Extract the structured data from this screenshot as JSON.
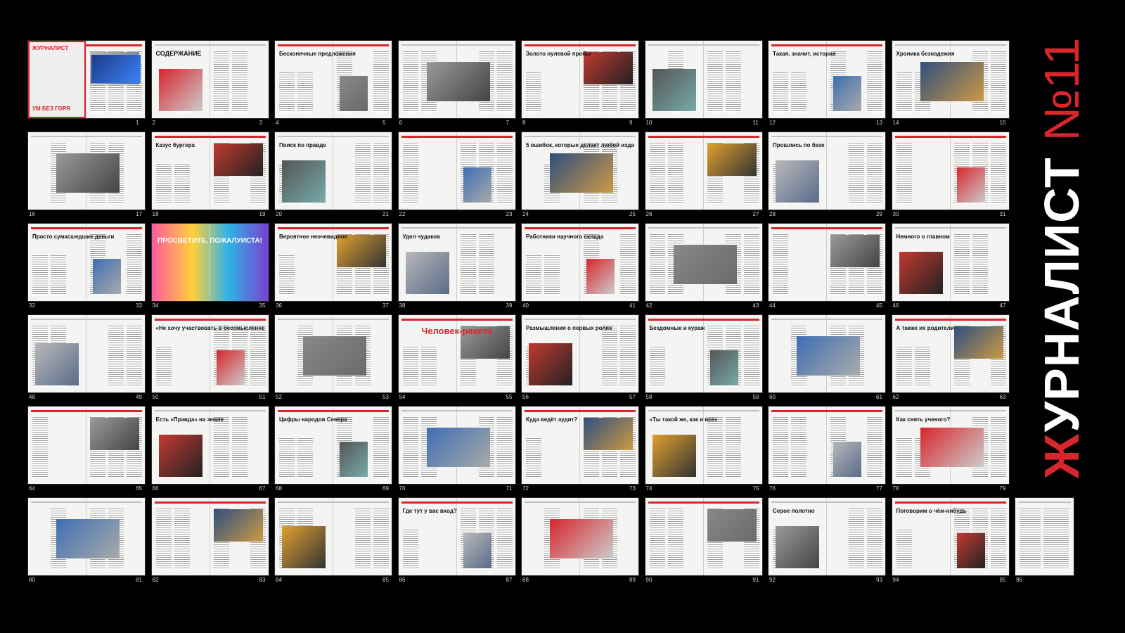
{
  "masthead": {
    "title": "ЖУРНАЛИСТ",
    "first_letter": "Ж",
    "rest": "УРНАЛИСТ",
    "issue": "№11"
  },
  "colors": {
    "background": "#000000",
    "accent": "#d8262c",
    "page": "#f4f4f2"
  },
  "rows": [
    {
      "spreads": [
        {
          "left": "",
          "right": "1",
          "headline": "ЖУРНАЛИСТ",
          "sub": "УМ БЕЗ ГОРЯ"
        },
        {
          "left": "2",
          "right": "3",
          "headline": "СОДЕРЖАНИЕ"
        },
        {
          "left": "4",
          "right": "5",
          "headline": "Бесконечные предложения"
        },
        {
          "left": "6",
          "right": "7",
          "headline": ""
        },
        {
          "left": "8",
          "right": "9",
          "headline": "Золото нулевой пробы"
        },
        {
          "left": "10",
          "right": "11",
          "headline": ""
        },
        {
          "left": "12",
          "right": "13",
          "headline": "Такая, значит, история"
        },
        {
          "left": "14",
          "right": "15",
          "headline": "Хроника безнадежия"
        }
      ]
    },
    {
      "spreads": [
        {
          "left": "16",
          "right": "17",
          "headline": ""
        },
        {
          "left": "18",
          "right": "19",
          "headline": "Казус бургера"
        },
        {
          "left": "20",
          "right": "21",
          "headline": "Поиск по правде"
        },
        {
          "left": "22",
          "right": "23",
          "headline": ""
        },
        {
          "left": "24",
          "right": "25",
          "headline": "5 ошибок, которые делает любой издатель"
        },
        {
          "left": "26",
          "right": "27",
          "headline": ""
        },
        {
          "left": "28",
          "right": "29",
          "headline": "Прошлись по базе"
        },
        {
          "left": "30",
          "right": "31",
          "headline": ""
        }
      ]
    },
    {
      "spreads": [
        {
          "left": "32",
          "right": "33",
          "headline": "Просто сумасшедшие деньги"
        },
        {
          "left": "34",
          "right": "35",
          "headline": "ПРОСВЕТИТЕ, ПОЖАЛУЙСТА!"
        },
        {
          "left": "36",
          "right": "37",
          "headline": "Вероятное неочевидное"
        },
        {
          "left": "38",
          "right": "39",
          "headline": "Удел чудаков"
        },
        {
          "left": "40",
          "right": "41",
          "headline": "Работники научного склада"
        },
        {
          "left": "42",
          "right": "43",
          "headline": ""
        },
        {
          "left": "44",
          "right": "45",
          "headline": ""
        },
        {
          "left": "46",
          "right": "47",
          "headline": "Немного о главном"
        }
      ]
    },
    {
      "spreads": [
        {
          "left": "48",
          "right": "49",
          "headline": ""
        },
        {
          "left": "50",
          "right": "51",
          "headline": "«Не хочу участвовать в бессмысленном накоплении знаний»"
        },
        {
          "left": "52",
          "right": "53",
          "headline": ""
        },
        {
          "left": "54",
          "right": "55",
          "headline": "Человек-ракета"
        },
        {
          "left": "56",
          "right": "57",
          "headline": "Размышления о первых ролях"
        },
        {
          "left": "58",
          "right": "59",
          "headline": "Бездомные и кураж"
        },
        {
          "left": "60",
          "right": "61",
          "headline": ""
        },
        {
          "left": "62",
          "right": "63",
          "headline": "А также их родители"
        }
      ]
    },
    {
      "spreads": [
        {
          "left": "64",
          "right": "65",
          "headline": ""
        },
        {
          "left": "66",
          "right": "67",
          "headline": "Есть «Правда» на земле"
        },
        {
          "left": "68",
          "right": "69",
          "headline": "Цифры народов Севера"
        },
        {
          "left": "70",
          "right": "71",
          "headline": ""
        },
        {
          "left": "72",
          "right": "73",
          "headline": "Куда ведёт аудит?"
        },
        {
          "left": "74",
          "right": "75",
          "headline": "«Ты такой же, как и все»"
        },
        {
          "left": "76",
          "right": "77",
          "headline": ""
        },
        {
          "left": "78",
          "right": "79",
          "headline": "Как снять ученого?"
        }
      ]
    },
    {
      "spreads": [
        {
          "left": "80",
          "right": "81",
          "headline": ""
        },
        {
          "left": "82",
          "right": "83",
          "headline": ""
        },
        {
          "left": "84",
          "right": "85",
          "headline": ""
        },
        {
          "left": "86",
          "right": "87",
          "headline": "Где тут у вас вход?"
        },
        {
          "left": "88",
          "right": "89",
          "headline": ""
        },
        {
          "left": "90",
          "right": "91",
          "headline": ""
        },
        {
          "left": "92",
          "right": "93",
          "headline": "Серое полотно"
        },
        {
          "left": "94",
          "right": "95",
          "headline": "Поговорим о чём-нибудь"
        },
        {
          "left": "96",
          "right": "",
          "headline": "",
          "single": true
        }
      ]
    }
  ]
}
